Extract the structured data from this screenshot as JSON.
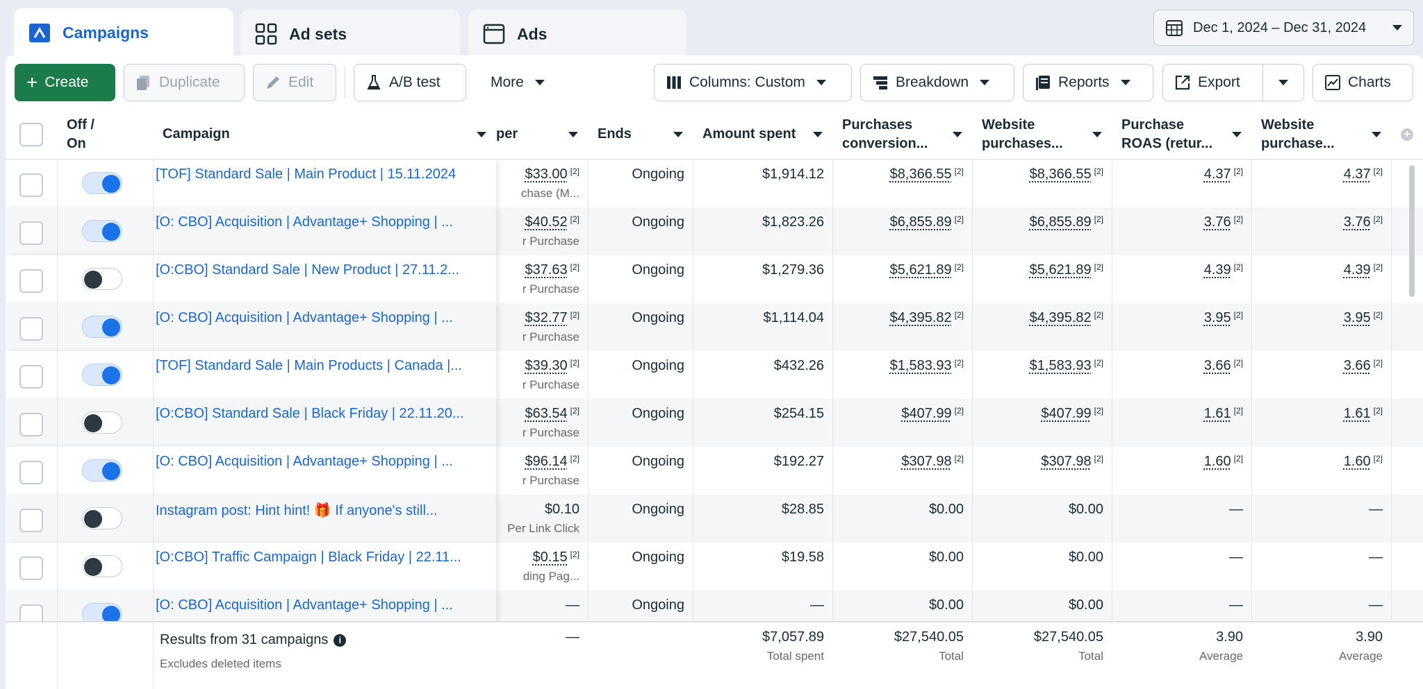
{
  "tabs": [
    {
      "label": "Campaigns"
    },
    {
      "label": "Ad sets"
    },
    {
      "label": "Ads"
    }
  ],
  "date_range": "Dec 1, 2024 – Dec 31, 2024",
  "toolbar": {
    "create": "Create",
    "duplicate": "Duplicate",
    "edit": "Edit",
    "ab_test": "A/B test",
    "more": "More",
    "columns": "Columns: Custom",
    "breakdown": "Breakdown",
    "reports": "Reports",
    "export": "Export",
    "charts": "Charts"
  },
  "columns": {
    "offon": "Off / On",
    "campaign": "Campaign",
    "cost": "per",
    "ends": "Ends",
    "spent": "Amount spent",
    "purch_conv": "Purchases conversion...",
    "web_purch": "Website purchases...",
    "roas": "Purchase ROAS (retur...",
    "web_purch2": "Website purchase..."
  },
  "rows": [
    {
      "on": true,
      "name": "[TOF] Standard Sale | Main Product | 15.11.2024",
      "cost": "$33.00",
      "cost_sup": "[2]",
      "cost_sub": "chase (M...",
      "ends": "Ongoing",
      "spent": "$1,914.12",
      "pc": "$8,366.55",
      "pc_sup": "[2]",
      "wp": "$8,366.55",
      "wp_sup": "[2]",
      "roas": "4.37",
      "roas_sup": "[2]",
      "wp2": "4.37",
      "wp2_sup": "[2]"
    },
    {
      "on": true,
      "name": "[O: CBO] Acquisition | Advantage+ Shopping | ...",
      "cost": "$40.52",
      "cost_sup": "[2]",
      "cost_sub": "r Purchase",
      "ends": "Ongoing",
      "spent": "$1,823.26",
      "pc": "$6,855.89",
      "pc_sup": "[2]",
      "wp": "$6,855.89",
      "wp_sup": "[2]",
      "roas": "3.76",
      "roas_sup": "[2]",
      "wp2": "3.76",
      "wp2_sup": "[2]"
    },
    {
      "on": false,
      "name": "[O:CBO] Standard Sale | New Product | 27.11.2...",
      "cost": "$37.63",
      "cost_sup": "[2]",
      "cost_sub": "r Purchase",
      "ends": "Ongoing",
      "spent": "$1,279.36",
      "pc": "$5,621.89",
      "pc_sup": "[2]",
      "wp": "$5,621.89",
      "wp_sup": "[2]",
      "roas": "4.39",
      "roas_sup": "[2]",
      "wp2": "4.39",
      "wp2_sup": "[2]"
    },
    {
      "on": true,
      "name": "[O: CBO] Acquisition | Advantage+ Shopping | ...",
      "cost": "$32.77",
      "cost_sup": "[2]",
      "cost_sub": "r Purchase",
      "ends": "Ongoing",
      "spent": "$1,114.04",
      "pc": "$4,395.82",
      "pc_sup": "[2]",
      "wp": "$4,395.82",
      "wp_sup": "[2]",
      "roas": "3.95",
      "roas_sup": "[2]",
      "wp2": "3.95",
      "wp2_sup": "[2]"
    },
    {
      "on": true,
      "name": "[TOF] Standard Sale | Main Products | Canada |...",
      "cost": "$39.30",
      "cost_sup": "[2]",
      "cost_sub": "r Purchase",
      "ends": "Ongoing",
      "spent": "$432.26",
      "pc": "$1,583.93",
      "pc_sup": "[2]",
      "wp": "$1,583.93",
      "wp_sup": "[2]",
      "roas": "3.66",
      "roas_sup": "[2]",
      "wp2": "3.66",
      "wp2_sup": "[2]"
    },
    {
      "on": false,
      "name": "[O:CBO] Standard Sale | Black Friday | 22.11.20...",
      "cost": "$63.54",
      "cost_sup": "[2]",
      "cost_sub": "r Purchase",
      "ends": "Ongoing",
      "spent": "$254.15",
      "pc": "$407.99",
      "pc_sup": "[2]",
      "wp": "$407.99",
      "wp_sup": "[2]",
      "roas": "1.61",
      "roas_sup": "[2]",
      "wp2": "1.61",
      "wp2_sup": "[2]"
    },
    {
      "on": true,
      "name": "[O: CBO] Acquisition | Advantage+ Shopping | ...",
      "cost": "$96.14",
      "cost_sup": "[2]",
      "cost_sub": "r Purchase",
      "ends": "Ongoing",
      "spent": "$192.27",
      "pc": "$307.98",
      "pc_sup": "[2]",
      "wp": "$307.98",
      "wp_sup": "[2]",
      "roas": "1.60",
      "roas_sup": "[2]",
      "wp2": "1.60",
      "wp2_sup": "[2]"
    },
    {
      "on": false,
      "name": "Instagram post: Hint hint! 🎁 If anyone's still...",
      "cost": "$0.10",
      "cost_sup": "",
      "cost_sub": "Per Link Click",
      "ends": "Ongoing",
      "spent": "$28.85",
      "pc": "$0.00",
      "pc_sup": "",
      "wp": "$0.00",
      "wp_sup": "",
      "roas": "—",
      "roas_sup": "",
      "wp2": "—",
      "wp2_sup": ""
    },
    {
      "on": false,
      "name": "[O:CBO] Traffic Campaign | Black Friday | 22.11...",
      "cost": "$0.15",
      "cost_sup": "[2]",
      "cost_sub": "ding Pag...",
      "ends": "Ongoing",
      "spent": "$19.58",
      "pc": "$0.00",
      "pc_sup": "",
      "wp": "$0.00",
      "wp_sup": "",
      "roas": "—",
      "roas_sup": "",
      "wp2": "—",
      "wp2_sup": ""
    },
    {
      "on": true,
      "name": "[O: CBO] Acquisition | Advantage+ Shopping | ...",
      "cost": "—",
      "cost_sup": "",
      "cost_sub": "",
      "ends": "Ongoing",
      "spent": "—",
      "pc": "$0.00",
      "pc_sup": "",
      "wp": "$0.00",
      "wp_sup": "",
      "roas": "—",
      "roas_sup": "",
      "wp2": "—",
      "wp2_sup": ""
    }
  ],
  "footer": {
    "results": "Results from 31 campaigns",
    "excludes": "Excludes deleted items",
    "cost": "—",
    "spent": "$7,057.89",
    "spent_label": "Total spent",
    "pc": "$27,540.05",
    "pc_label": "Total",
    "wp": "$27,540.05",
    "wp_label": "Total",
    "roas": "3.90",
    "roas_label": "Average",
    "wp2": "3.90",
    "wp2_label": "Average"
  },
  "colors": {
    "accent": "#1a66d1",
    "create": "#1b7b4a"
  }
}
